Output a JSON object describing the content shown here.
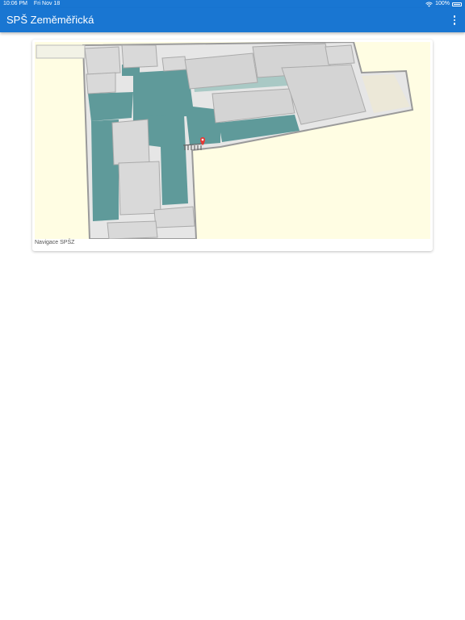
{
  "status_bar": {
    "time": "10:06 PM",
    "date": "Fri Nov 18",
    "wifi_icon": "wifi-icon",
    "battery_percent": "100%",
    "battery_icon": "battery-icon"
  },
  "app_bar": {
    "title": "SPŠ Zeměměřická",
    "menu_icon": "more-vert-icon",
    "background_color": "#1976d2"
  },
  "cards": [
    {
      "caption": "Navigace SPŠZ",
      "image_icon": "floor-plan-map-image",
      "marker_icon": "location-pin-icon"
    }
  ]
}
